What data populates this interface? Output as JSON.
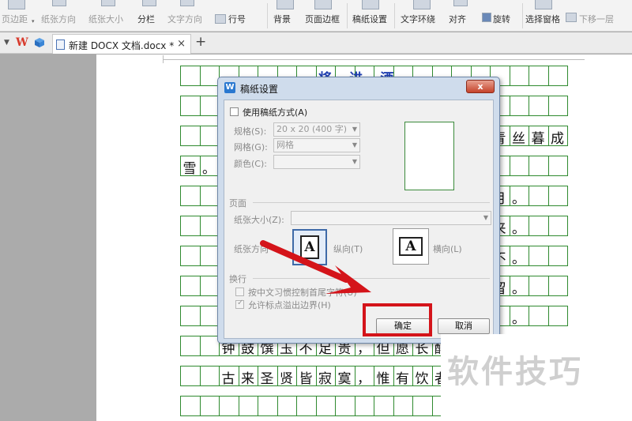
{
  "ribbon": {
    "page_margin": "页边距",
    "paper_orientation": "纸张方向",
    "paper_size": "纸张大小",
    "columns": "分栏",
    "text_direction": "文字方向",
    "line_number": "行号",
    "background": "背景",
    "page_border": "页面边框",
    "manuscript_settings": "稿纸设置",
    "text_wrap": "文字环绕",
    "align": "对齐",
    "rotate": "旋转",
    "selection_pane": "选择窗格",
    "move_down": "下移一层"
  },
  "tabbar": {
    "logo": "W",
    "doc_tab_title": "新建 DOCX 文档.docx *",
    "close_glyph": "×",
    "add_glyph": "+"
  },
  "document": {
    "title_chars": [
      "将",
      "进",
      "酒"
    ],
    "row1_tail": [
      "青",
      "丝",
      "暮",
      "成"
    ],
    "row2_head": [
      "雪",
      "。"
    ],
    "right_fragments": [
      "月",
      "。",
      "来",
      "。",
      "不",
      "。",
      "留",
      "。",
      "。"
    ],
    "line_a": [
      "钟",
      "鼓",
      "馔",
      "玉",
      "不",
      "足",
      "贵",
      "，",
      "但",
      "愿",
      "长",
      "醉"
    ],
    "line_b": [
      "古",
      "来",
      "圣",
      "贤",
      "皆",
      "寂",
      "寞",
      "，",
      "惟",
      "有",
      "饮",
      "者"
    ]
  },
  "dialog": {
    "title": "稿纸设置",
    "close_glyph": "x",
    "use_grid_label": "使用稿纸方式(A)",
    "spec_label": "规格(S):",
    "spec_value": "20 x 20 (400 字)",
    "grid_label": "网格(G):",
    "grid_value": "网格",
    "color_label": "颜色(C):",
    "color_value": "",
    "page_section": "页面",
    "paper_size_label": "纸张大小(Z):",
    "paper_size_value": "",
    "orientation_label": "纸张方向",
    "portrait_label": "纵向(T)",
    "landscape_label": "横向(L)",
    "icon_glyph": "A",
    "wrap_section": "换行",
    "chinese_wrap_label": "按中文习惯控制首尾字符(U)",
    "punct_overflow_label": "允许标点溢出边界(H)",
    "ok_button": "确定",
    "cancel_button": "取消"
  },
  "watermark": "软件技巧",
  "colors": {
    "grid_green": "#2f8a2f",
    "title_blue": "#1f3fb0",
    "annotation_red": "#d4141a",
    "wps_red": "#d83a2c"
  }
}
